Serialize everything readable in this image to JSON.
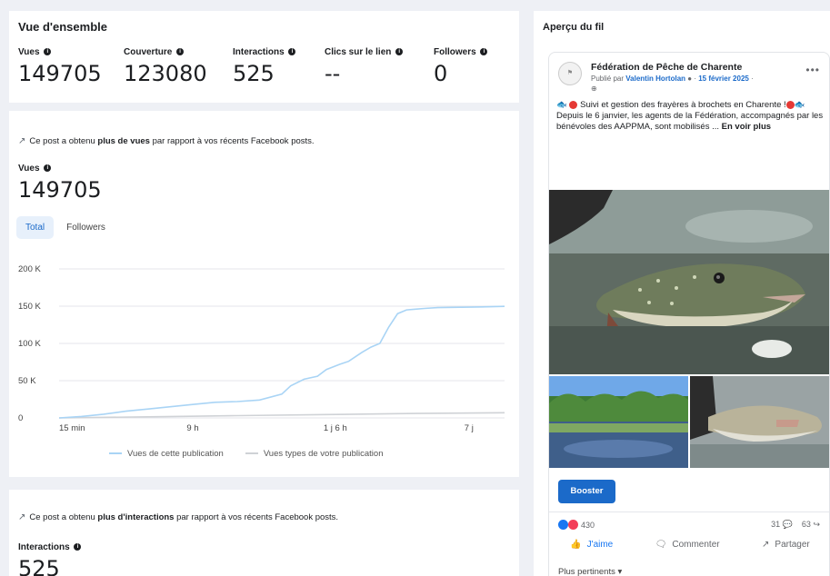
{
  "overview": {
    "title": "Vue d'ensemble",
    "metrics": [
      {
        "label": "Vues",
        "value": "149705",
        "info": "true"
      },
      {
        "label": "Couverture",
        "value": "123080",
        "info": "true"
      },
      {
        "label": "Interactions",
        "value": "525",
        "info": "true"
      },
      {
        "label": "Clics sur le lien",
        "value": "--",
        "info": "true"
      },
      {
        "label": "Followers",
        "value": "0",
        "info": "true"
      }
    ]
  },
  "views_card": {
    "insight_prefix": "Ce post a obtenu ",
    "insight_bold": "plus de vues",
    "insight_suffix": " par rapport à vos récents Facebook posts.",
    "metric_label": "Vues",
    "metric_value": "149705",
    "tabs": [
      {
        "label": "Total",
        "active": true
      },
      {
        "label": "Followers",
        "active": false
      }
    ],
    "legend": [
      "Vues de cette publication",
      "Vues types de votre publication"
    ]
  },
  "interactions_card": {
    "insight_prefix": "Ce post a obtenu ",
    "insight_bold": "plus d'interactions",
    "insight_suffix": " par rapport à vos récents Facebook posts.",
    "metric_label": "Interactions",
    "metric_value": "525"
  },
  "chart_data": {
    "type": "line",
    "x_tick_labels": [
      "15 min",
      "9 h",
      "1 j 6 h",
      "7 j"
    ],
    "y_tick_labels": [
      "0",
      "50 K",
      "100 K",
      "150 K",
      "200 K"
    ],
    "ylim": [
      0,
      200000
    ],
    "xlim": [
      0,
      100
    ],
    "grid": true,
    "legend_position": "bottom",
    "colors": {
      "series1": "#a9d4f5",
      "series2": "#cfd2d6"
    },
    "series": [
      {
        "name": "Vues de cette publication",
        "x": [
          0,
          5,
          10,
          15,
          20,
          25,
          30,
          35,
          40,
          45,
          50,
          52,
          55,
          58,
          60,
          63,
          65,
          68,
          70,
          72,
          74,
          76,
          78,
          80,
          82,
          85,
          90,
          95,
          100
        ],
        "y": [
          0,
          2000,
          5000,
          9000,
          12000,
          15000,
          18000,
          21000,
          22000,
          24000,
          32000,
          43000,
          52000,
          56000,
          65000,
          72000,
          76000,
          88000,
          95000,
          100000,
          122000,
          140000,
          145000,
          146000,
          147000,
          148000,
          148500,
          149000,
          149705
        ]
      },
      {
        "name": "Vues types de votre publication",
        "x": [
          0,
          20,
          40,
          60,
          80,
          100
        ],
        "y": [
          0,
          1500,
          3000,
          4500,
          6000,
          7000
        ]
      }
    ]
  },
  "feed": {
    "title": "Aperçu du fil",
    "post": {
      "page_name": "Fédération de Pêche de Charente",
      "byline_prefix": "Publié par ",
      "author": "Valentin Hortolan",
      "date": "15 février 2025",
      "text_line1": "Suivi et gestion des frayères à brochets en Charente !",
      "text_line2": "Depuis le 6 janvier, les agents de la Fédération, accompagnés par les bénévoles des AAPPMA, sont mobilisés ... ",
      "see_more": "En voir plus",
      "boost_label": "Booster",
      "reaction_count": "430",
      "comment_count": "31",
      "share_count": "63",
      "like_label": "J'aime",
      "comment_label": "Commenter",
      "share_label": "Partager",
      "sort_label": "Plus pertinents"
    }
  }
}
